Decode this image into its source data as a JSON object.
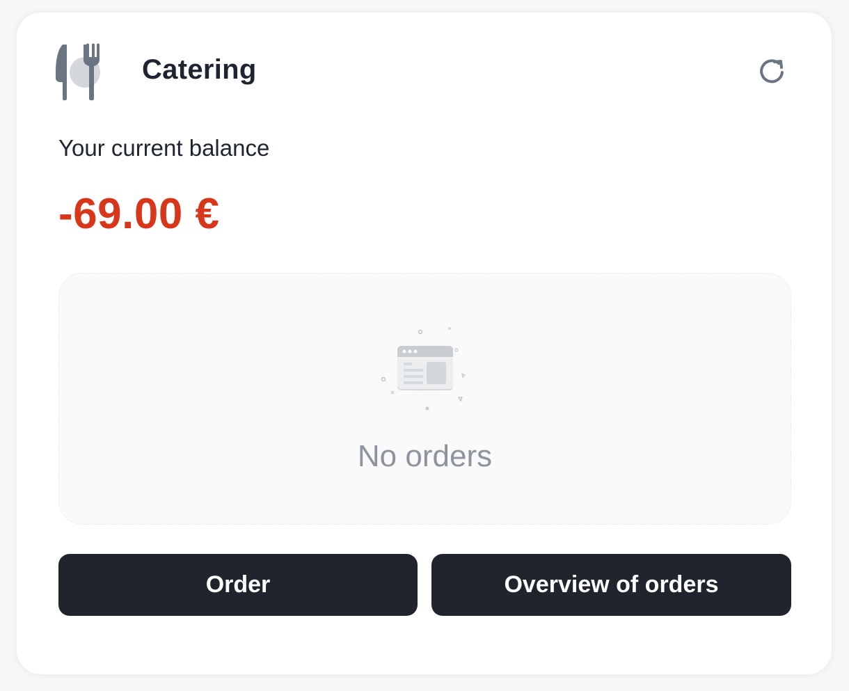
{
  "widget": {
    "title": "Catering",
    "icon": "cutlery-plate-icon",
    "refresh_icon": "refresh-icon"
  },
  "balance": {
    "label": "Your current balance",
    "amount": "-69.00 €",
    "amount_color": "#d8361a"
  },
  "orders": {
    "empty_icon": "empty-browser-window-icon",
    "empty_text": "No orders"
  },
  "actions": {
    "order_label": "Order",
    "overview_label": "Overview of orders",
    "button_color": "#1f242d"
  }
}
